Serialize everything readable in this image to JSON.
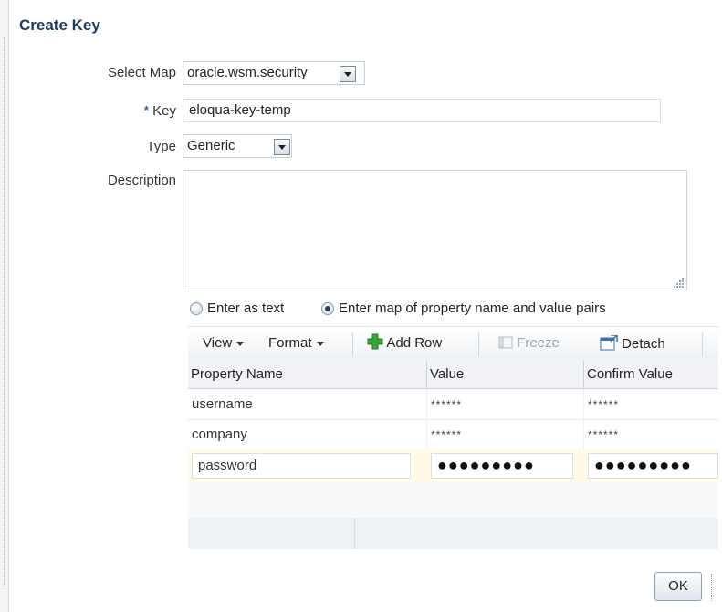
{
  "dialog": {
    "title": "Create Key"
  },
  "form": {
    "select_map": {
      "label": "Select Map",
      "value": "oracle.wsm.security"
    },
    "key": {
      "required_marker": "*",
      "label": "Key",
      "value": "eloqua-key-temp"
    },
    "type": {
      "label": "Type",
      "value": "Generic"
    },
    "description": {
      "label": "Description",
      "value": ""
    }
  },
  "mode": {
    "options": [
      {
        "label": "Enter as text",
        "selected": false
      },
      {
        "label": "Enter map of property name and value pairs",
        "selected": true
      }
    ]
  },
  "toolbar": {
    "view": "View",
    "format": "Format",
    "add_row": "Add Row",
    "freeze": "Freeze",
    "detach": "Detach"
  },
  "table": {
    "columns": [
      "Property Name",
      "Value",
      "Confirm Value"
    ],
    "rows": [
      {
        "name": "username",
        "value": "******",
        "confirm": "******"
      },
      {
        "name": "company",
        "value": "******",
        "confirm": "******"
      }
    ],
    "edit_row": {
      "name": "password",
      "value": "●●●●●●●●●",
      "confirm": "●●●●●●●●●"
    }
  },
  "footer": {
    "ok_label": "OK"
  },
  "colors": {
    "title": "#1d3b5e",
    "accent_green": "#2e9b2e",
    "edit_row_bg": "#fffbe6"
  }
}
